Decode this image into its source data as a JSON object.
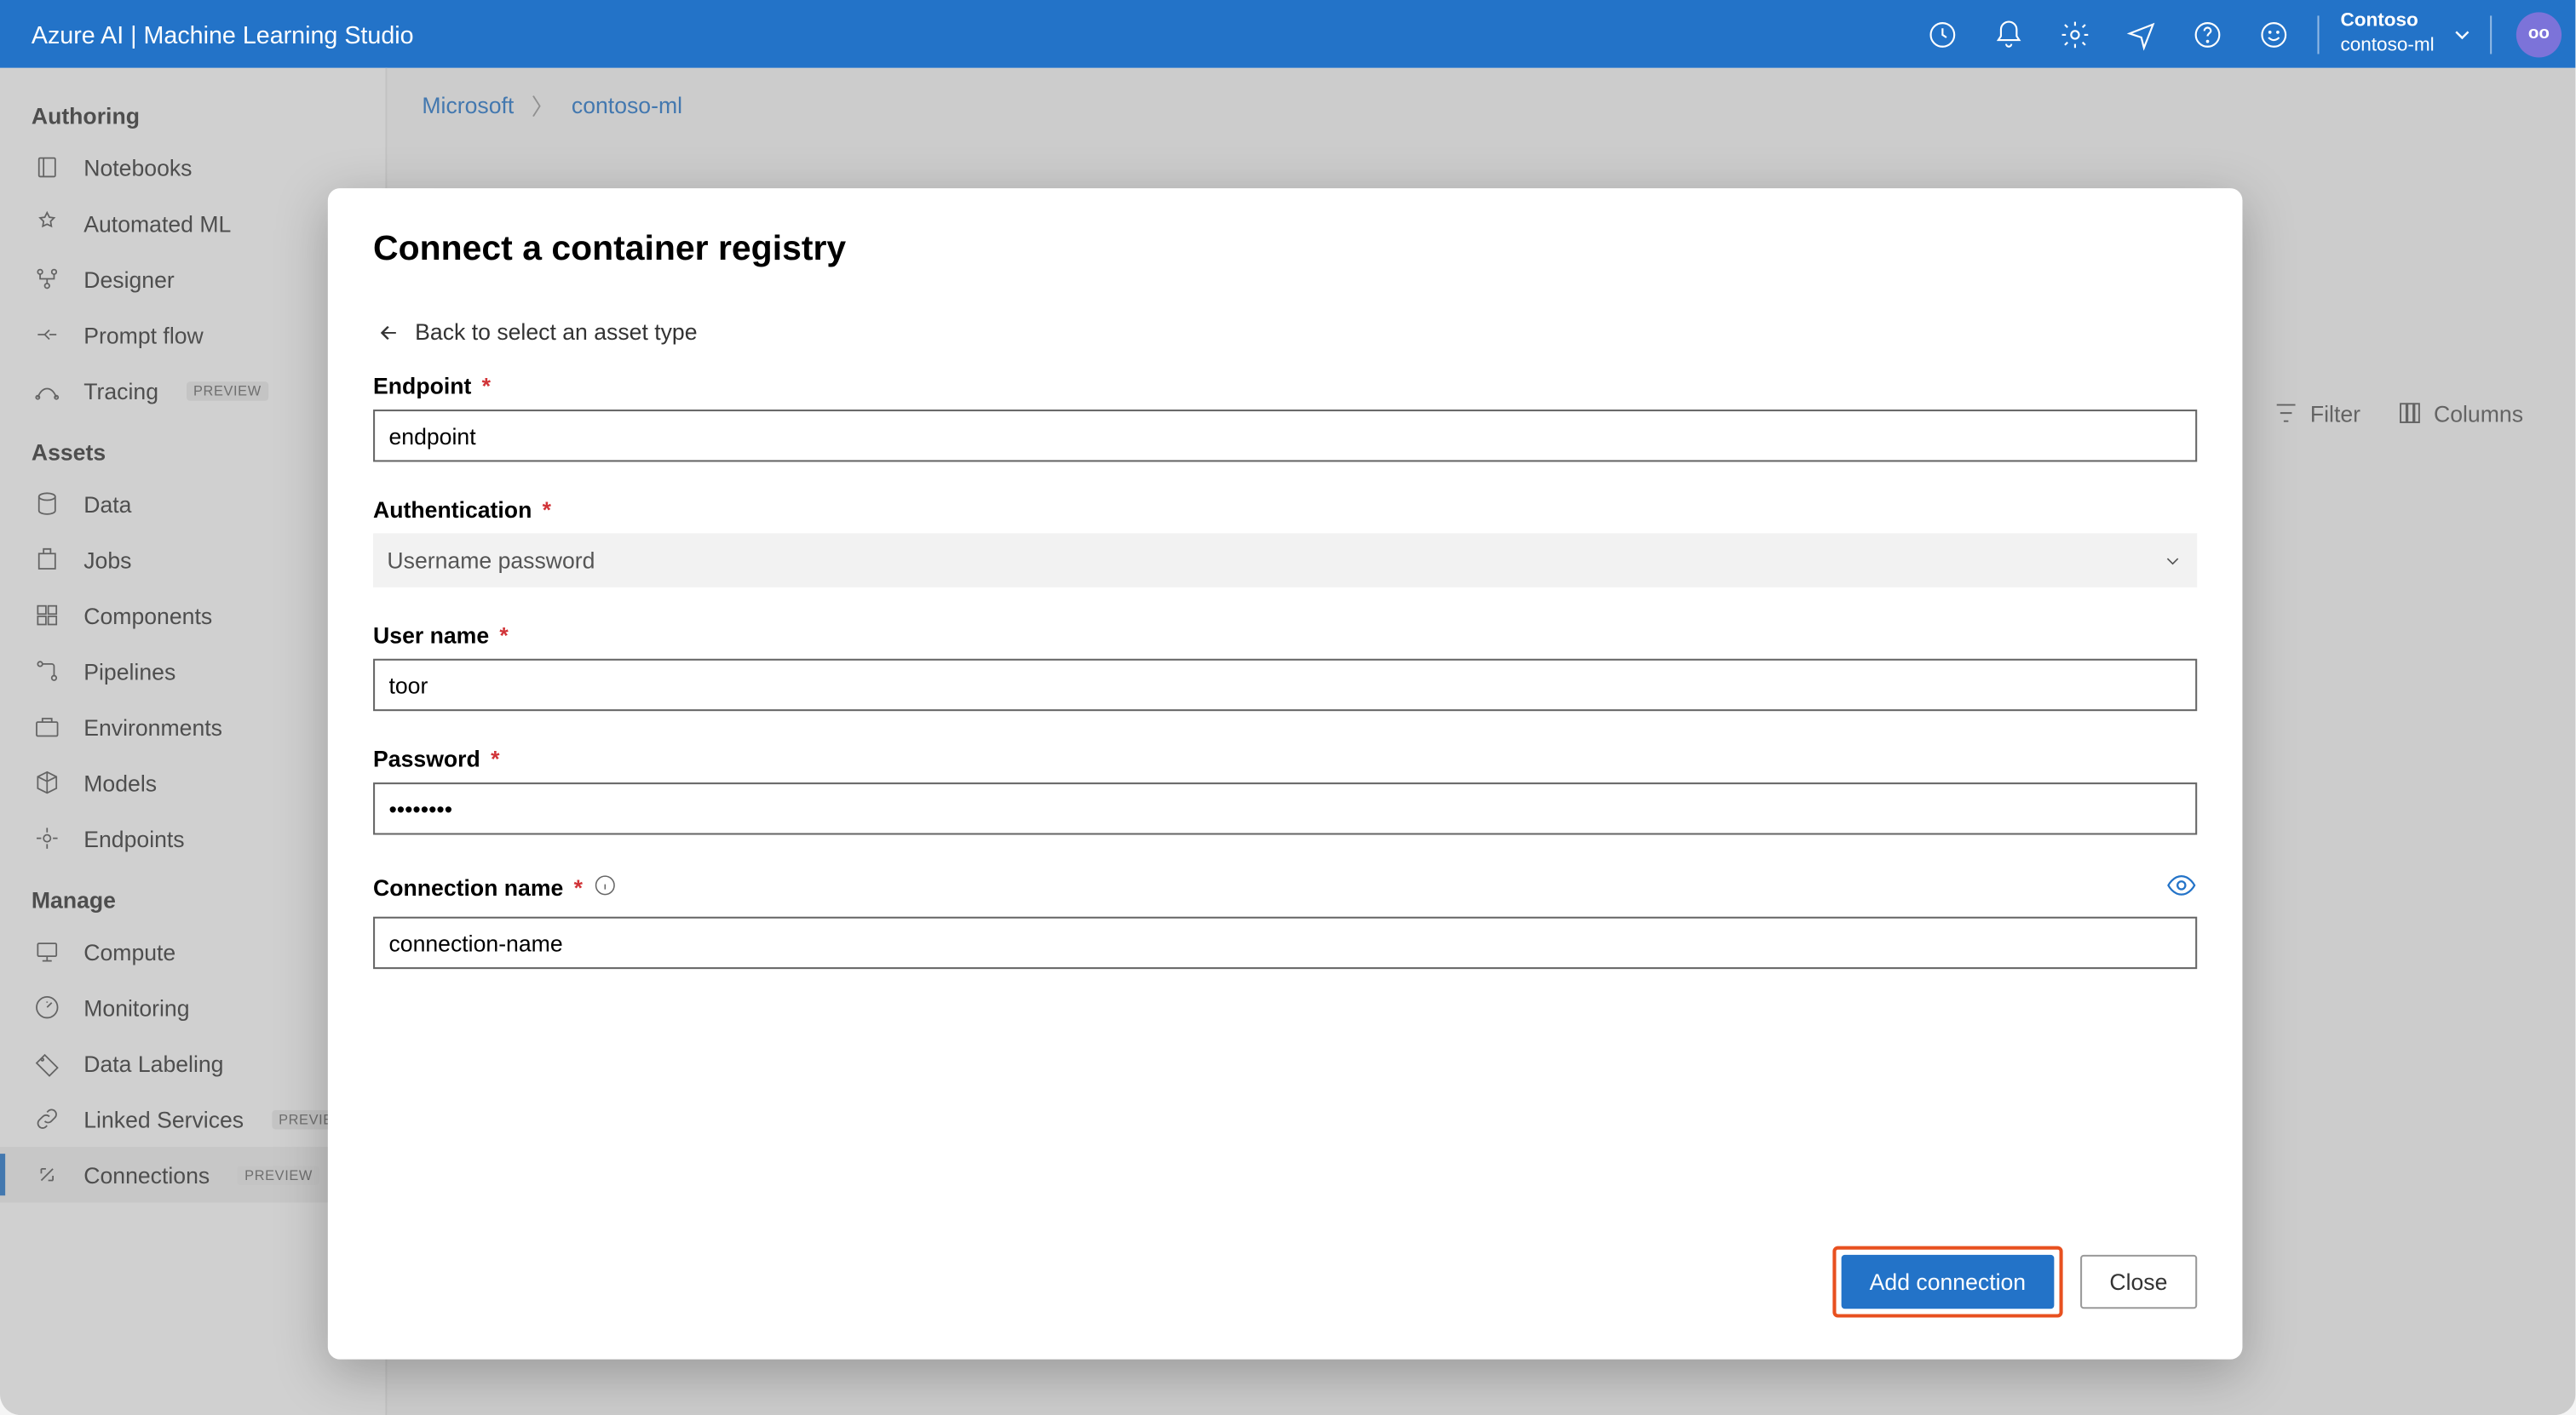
{
  "header": {
    "title": "Azure AI | Machine Learning Studio",
    "tenant_org": "Contoso",
    "tenant_workspace": "contoso-ml",
    "avatar_initials": "oo"
  },
  "breadcrumb": {
    "root": "Microsoft",
    "current": "contoso-ml"
  },
  "sidebar": {
    "sections": [
      {
        "title": "Authoring",
        "items": [
          {
            "label": "Notebooks",
            "icon": "notebooks"
          },
          {
            "label": "Automated ML",
            "icon": "automl"
          },
          {
            "label": "Designer",
            "icon": "designer"
          },
          {
            "label": "Prompt flow",
            "icon": "promptflow"
          },
          {
            "label": "Tracing",
            "icon": "tracing",
            "preview": true
          }
        ]
      },
      {
        "title": "Assets",
        "items": [
          {
            "label": "Data",
            "icon": "data"
          },
          {
            "label": "Jobs",
            "icon": "jobs"
          },
          {
            "label": "Components",
            "icon": "components"
          },
          {
            "label": "Pipelines",
            "icon": "pipelines"
          },
          {
            "label": "Environments",
            "icon": "environments"
          },
          {
            "label": "Models",
            "icon": "models"
          },
          {
            "label": "Endpoints",
            "icon": "endpoints"
          }
        ]
      },
      {
        "title": "Manage",
        "items": [
          {
            "label": "Compute",
            "icon": "compute"
          },
          {
            "label": "Monitoring",
            "icon": "monitoring"
          },
          {
            "label": "Data Labeling",
            "icon": "labeling"
          },
          {
            "label": "Linked Services",
            "icon": "linked",
            "preview": true
          },
          {
            "label": "Connections",
            "icon": "connections",
            "preview": true,
            "active": true
          }
        ]
      }
    ]
  },
  "toolbar": {
    "filter": "Filter",
    "columns": "Columns"
  },
  "modal": {
    "title": "Connect a container registry",
    "back_text": "Back to select an asset type",
    "fields": {
      "endpoint_label": "Endpoint",
      "endpoint_value": "endpoint",
      "auth_label": "Authentication",
      "auth_value": "Username password",
      "username_label": "User name",
      "username_value": "toor",
      "password_label": "Password",
      "password_value": "••••••••",
      "connection_label": "Connection name",
      "connection_value": "connection-name"
    },
    "buttons": {
      "add": "Add connection",
      "close": "Close"
    }
  },
  "preview_badge": "PREVIEW"
}
